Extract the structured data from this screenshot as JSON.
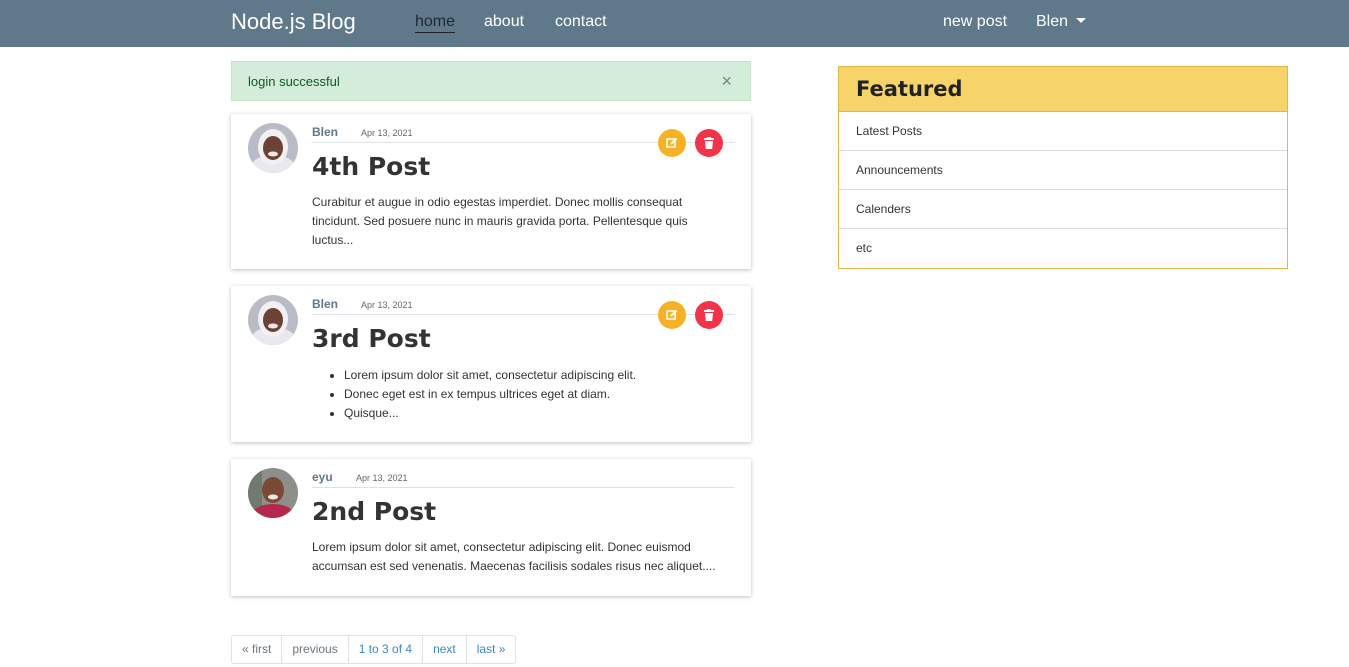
{
  "navbar": {
    "brand": "Node.js Blog",
    "links": [
      {
        "label": "home",
        "active": true
      },
      {
        "label": "about"
      },
      {
        "label": "contact"
      }
    ],
    "new_post": "new post",
    "user": "Blen"
  },
  "alert": {
    "message": "login successful",
    "close": "×"
  },
  "posts": [
    {
      "author": "Blen",
      "date": "Apr 13, 2021",
      "title": "4th Post",
      "excerpt": "Curabitur et augue in odio egestas imperdiet. Donec mollis consequat tincidunt. Sed posuere nunc in mauris gravida porta. Pellentesque quis luctus...",
      "avatar": "woman-avatar",
      "actions": {
        "edit": "edit-icon",
        "delete": "trash-icon"
      }
    },
    {
      "author": "Blen",
      "date": "Apr 13, 2021",
      "title": "3rd Post",
      "bullets": [
        "Lorem ipsum dolor sit amet, consectetur adipiscing elit.",
        "Donec eget est in ex tempus ultrices eget at diam.",
        "Quisque..."
      ],
      "avatar": "woman-avatar",
      "actions": {
        "edit": "edit-icon",
        "delete": "trash-icon"
      }
    },
    {
      "author": "eyu",
      "date": "Apr 13, 2021",
      "title": "2nd Post",
      "excerpt": "Lorem ipsum dolor sit amet, consectetur adipiscing elit. Donec euismod accumsan est sed venenatis. Maecenas facilisis sodales risus nec aliquet....",
      "avatar": "man-avatar"
    }
  ],
  "featured": {
    "title": "Featured",
    "items": [
      "Latest Posts",
      "Announcements",
      "Calenders",
      "etc"
    ]
  },
  "pagination": {
    "first": "« first",
    "previous": "previous",
    "range": "1 to 3 of 4",
    "next": "next",
    "last": "last »"
  },
  "colors": {
    "navbar": "#5f788a",
    "alert_bg": "#d4edda",
    "featured_header": "#f7d46a",
    "edit_button": "#f6b127",
    "delete_button": "#f2334a",
    "link": "#3a87c9"
  }
}
